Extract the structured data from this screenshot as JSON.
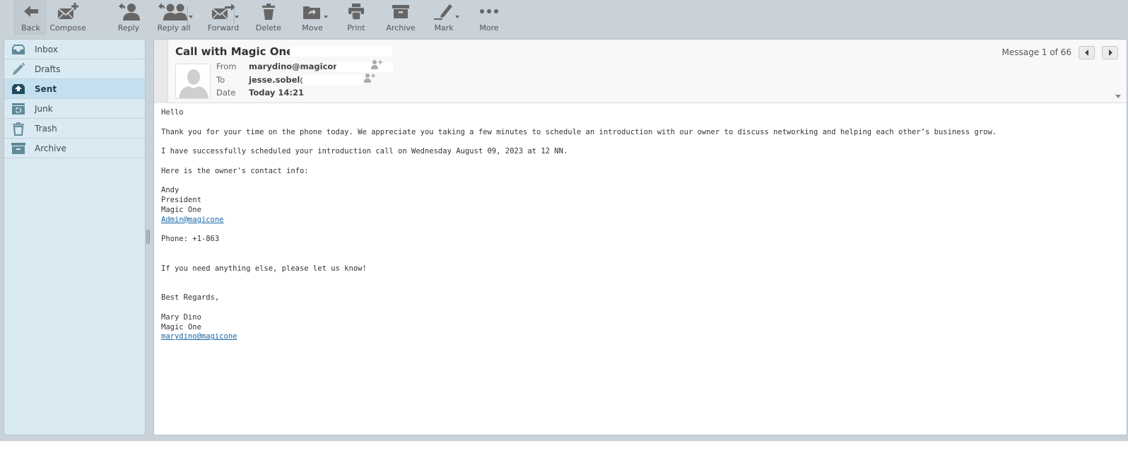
{
  "toolbar": {
    "buttons": [
      {
        "id": "back",
        "label": "Back",
        "icon": "back-arrow-icon"
      },
      {
        "id": "compose",
        "label": "Compose",
        "icon": "compose-icon"
      },
      {
        "id": "reply",
        "label": "Reply",
        "icon": "reply-icon"
      },
      {
        "id": "reply_all",
        "label": "Reply all",
        "icon": "reply-all-icon"
      },
      {
        "id": "forward",
        "label": "Forward",
        "icon": "forward-icon"
      },
      {
        "id": "delete",
        "label": "Delete",
        "icon": "trash-icon"
      },
      {
        "id": "move",
        "label": "Move",
        "icon": "move-folder-icon"
      },
      {
        "id": "print",
        "label": "Print",
        "icon": "printer-icon"
      },
      {
        "id": "archive",
        "label": "Archive",
        "icon": "archive-box-icon"
      },
      {
        "id": "mark",
        "label": "Mark",
        "icon": "marker-icon"
      },
      {
        "id": "more",
        "label": "More",
        "icon": "more-dots-icon"
      }
    ]
  },
  "sidebar": {
    "folders": [
      {
        "label": "Inbox",
        "icon": "inbox-icon",
        "active": false
      },
      {
        "label": "Drafts",
        "icon": "pencil-icon",
        "active": false
      },
      {
        "label": "Sent",
        "icon": "sent-icon",
        "active": true
      },
      {
        "label": "Junk",
        "icon": "junk-folder-icon",
        "active": false
      },
      {
        "label": "Trash",
        "icon": "trash-icon",
        "active": false
      },
      {
        "label": "Archive",
        "icon": "archive-box-icon",
        "active": false
      }
    ]
  },
  "message": {
    "subject": "Call with Magic One",
    "from_label": "From",
    "from_value": "marydino@magicone",
    "to_label": "To",
    "to_value": "jesse.sobel@",
    "date_label": "Date",
    "date_value": "Today 14:21",
    "counter": "Message 1 of 66",
    "body": {
      "greeting": "Hello",
      "p1": "Thank you for your time on the phone today. We appreciate you taking a few minutes to schedule an introduction with our owner to discuss networking and helping each other’s business grow.",
      "p2": "I have successfully scheduled your introduction call on Wednesday August 09, 2023 at 12 NN.",
      "p3": "Here is the owner's contact info:",
      "owner_name": "Andy",
      "owner_title": "President",
      "owner_company": "Magic One",
      "owner_email": "Admin@magicone",
      "phone": "Phone: +1-863",
      "closing_line": "If you need anything else, please let us know!",
      "regards": "Best Regards,",
      "sender_name": "Mary Dino",
      "sender_company": "Magic One",
      "sender_email": "marydino@magicone"
    }
  },
  "colors": {
    "app_background": "#c9d1d9",
    "sidebar_background": "#d9eaf2",
    "sidebar_active": "#c4e0ee",
    "link": "#1a66a8",
    "icon_gray": "#666666"
  }
}
